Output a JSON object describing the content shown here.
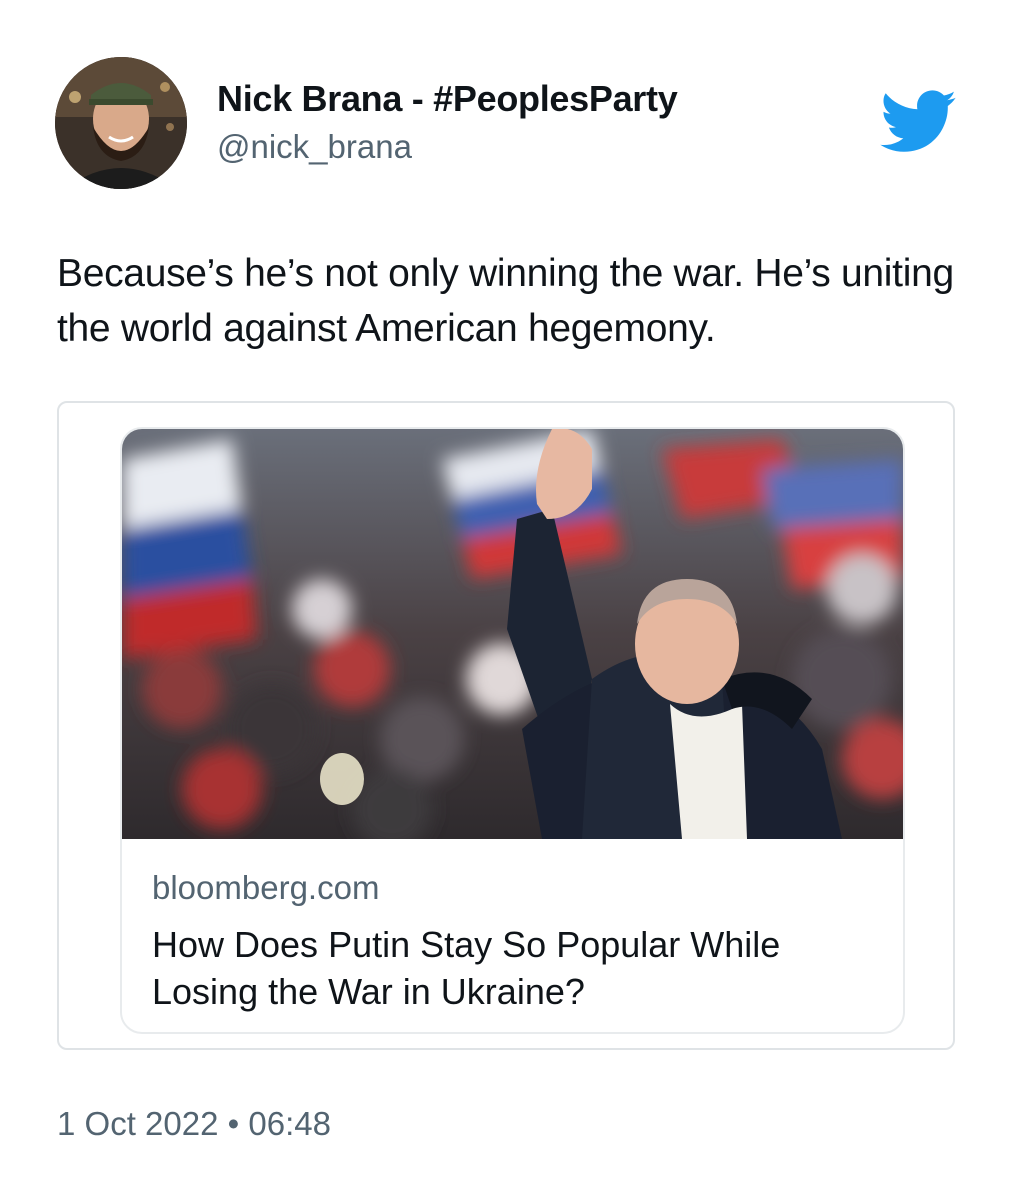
{
  "author": {
    "display_name": "Nick Brana - #PeoplesParty",
    "handle": "@nick_brana"
  },
  "logo_icon": "twitter-bird-icon",
  "brand_color": "#1d9bf0",
  "tweet": {
    "text": "Because’s he’s not only winning the war. He’s uniting the world against American hegemony."
  },
  "link_card": {
    "domain": "bloomberg.com",
    "title": "How Does Putin Stay So Popular While Losing the War in Ukraine?"
  },
  "meta": {
    "date": "1 Oct 2022",
    "separator": "•",
    "time": "06:48"
  }
}
